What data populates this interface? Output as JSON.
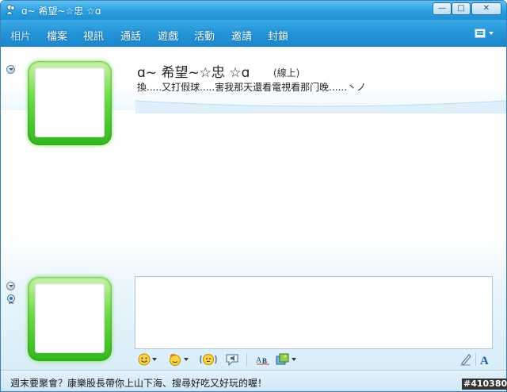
{
  "window": {
    "title": "ɑ~ 希望~☆忠 ☆ɑ",
    "controls": {
      "minimize": "—",
      "maximize": "□",
      "close": "✕"
    }
  },
  "menu": {
    "items": [
      "相片",
      "檔案",
      "視訊",
      "通話",
      "遊戲",
      "活動",
      "邀請",
      "封鎖"
    ]
  },
  "contact": {
    "name": "ɑ~ 希望~☆忠 ☆ɑ",
    "status": "(線上)",
    "personal_message": "換.....又打假球.....害我那天還看電視看那门晚......丶ノ"
  },
  "compose": {
    "value": "",
    "placeholder": ""
  },
  "toolbar": {
    "icons": [
      "smiley-icon",
      "wink-icon",
      "nudge-icon",
      "voice-clip-icon",
      "font-icon",
      "background-icon",
      "pen-icon",
      "text-format-icon"
    ]
  },
  "ad": {
    "text": "週末要聚會？康樂股長帶你上山下海、搜尋好吃又好玩的喔！"
  },
  "watermark": "#410380",
  "colors": {
    "titlebar": "#2ea2e1",
    "menubar": "#2596d9",
    "avatar_frame": "#31b81d",
    "compose_border": "#a9c6dd"
  }
}
